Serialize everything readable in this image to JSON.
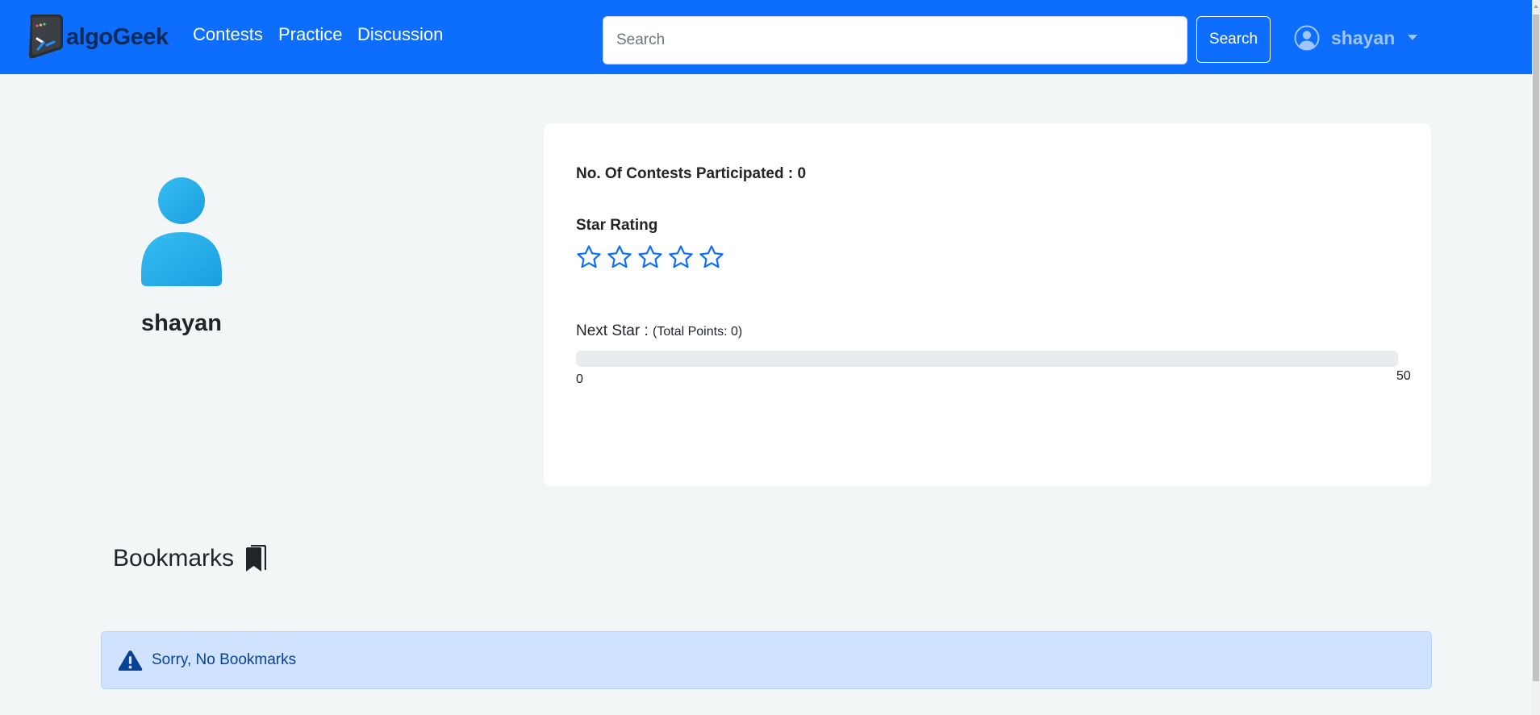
{
  "navbar": {
    "brand": "algoGeek",
    "links": [
      {
        "label": "Contests"
      },
      {
        "label": "Practice"
      },
      {
        "label": "Discussion"
      }
    ],
    "search": {
      "placeholder": "Search",
      "value": ""
    },
    "search_button_label": "Search",
    "user": {
      "name": "shayan"
    }
  },
  "profile": {
    "name": "shayan"
  },
  "stats": {
    "contests_label": "No. Of Contests Participated : ",
    "contests_value": "0",
    "star_rating_label": "Star Rating",
    "star_rating": {
      "filled": 0,
      "total": 5
    },
    "next_star_label": "Next Star : ",
    "total_points_text": "(Total Points: 0)",
    "progress": {
      "value": 0,
      "min": "0",
      "max": "50",
      "fraction": 0
    }
  },
  "bookmarks": {
    "title": "Bookmarks",
    "empty_message": "Sorry, No Bookmarks"
  },
  "colors": {
    "primary": "#0d6efd",
    "alert_bg": "#cfe2ff",
    "alert_text": "#084298"
  }
}
